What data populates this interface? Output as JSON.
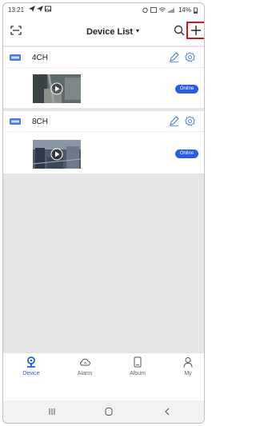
{
  "status_bar": {
    "time": "13:21",
    "battery": "14%"
  },
  "header": {
    "title": "Device List",
    "caret": "▾"
  },
  "devices": [
    {
      "name": "4CH",
      "status": "Online"
    },
    {
      "name": "8CH",
      "status": "Online"
    }
  ],
  "tabs": [
    {
      "label": "Device",
      "icon": "device-tab-icon",
      "active": true
    },
    {
      "label": "Alarm",
      "icon": "cloud-icon",
      "active": false
    },
    {
      "label": "Album",
      "icon": "album-icon",
      "active": false
    },
    {
      "label": "My",
      "icon": "person-icon",
      "active": false
    }
  ],
  "colors": {
    "accent": "#2b5be3",
    "highlight_box": "#e0101a",
    "list_background": "#e6e6e9"
  }
}
